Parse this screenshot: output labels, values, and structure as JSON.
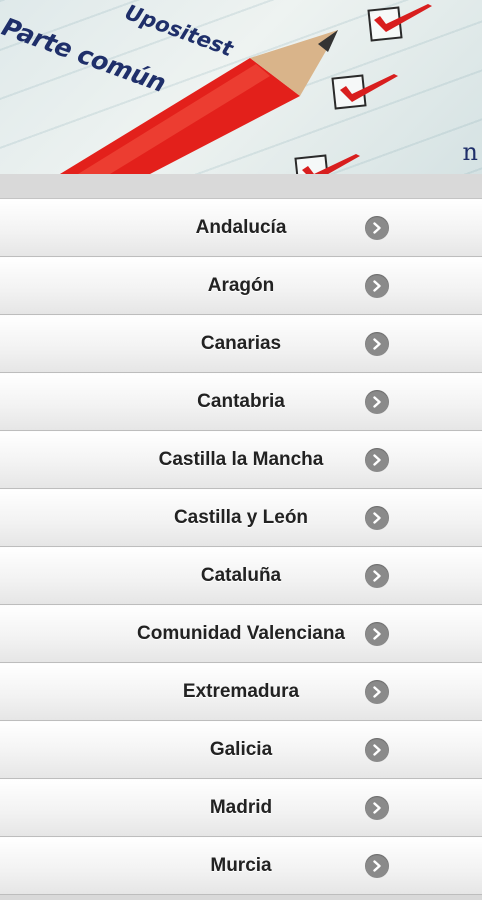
{
  "header": {
    "title": "Parte común",
    "brand": "Upositest",
    "edge_letter": "n"
  },
  "regions": [
    {
      "label": "Andalucía",
      "icon": "chevron-right-icon"
    },
    {
      "label": "Aragón",
      "icon": "chevron-right-icon"
    },
    {
      "label": "Canarias",
      "icon": "chevron-right-icon"
    },
    {
      "label": "Cantabria",
      "icon": "chevron-right-icon"
    },
    {
      "label": "Castilla la Mancha",
      "icon": "chevron-right-icon"
    },
    {
      "label": "Castilla y León",
      "icon": "chevron-right-icon"
    },
    {
      "label": "Cataluña",
      "icon": "chevron-right-icon"
    },
    {
      "label": "Comunidad Valenciana",
      "icon": "chevron-right-icon"
    },
    {
      "label": "Extremadura",
      "icon": "chevron-right-icon"
    },
    {
      "label": "Galicia",
      "icon": "chevron-right-icon"
    },
    {
      "label": "Madrid",
      "icon": "chevron-right-icon"
    },
    {
      "label": "Murcia",
      "icon": "chevron-right-icon"
    }
  ],
  "colors": {
    "title_text": "#1f2f6a",
    "check_red": "#d81e1e",
    "pencil_red": "#e3201b",
    "list_text": "#222222",
    "chevron_bg": "#8a8a8a"
  }
}
